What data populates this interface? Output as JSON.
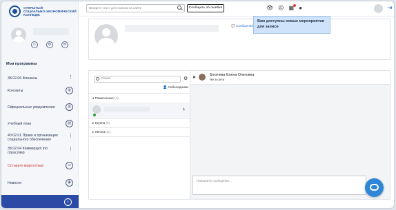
{
  "logo": {
    "line1": "ОТКРЫТЫЙ",
    "line2": "СОЦИАЛЬНО-ЭКОНОМИЧЕСКИЙ",
    "line3": "КОЛЛЕДЖ"
  },
  "sidebar": {
    "section_title": "Мои программы",
    "items": [
      {
        "label": "38.02.06 Финансы",
        "icon": "more-vert-icon"
      },
      {
        "label": "Контакты",
        "icon": "contacts-icon"
      },
      {
        "label": "Официальные уведомления",
        "icon": "notifications-icon"
      },
      {
        "label": "Учебный план",
        "icon": "plan-icon"
      },
      {
        "label": "40.02.01 Право и организация социального обеспечения",
        "icon": "more-vert-icon"
      },
      {
        "label": "38.02.04 Коммерция (по отраслям)",
        "icon": "more-vert-icon"
      },
      {
        "label": "Оставьте видеоотзыв",
        "icon": "video-icon"
      },
      {
        "label": "Новости",
        "icon": "news-icon"
      }
    ],
    "collapse_icon": "arrow-left-icon"
  },
  "topbar": {
    "search_placeholder": "Введите текст для поиска на сайте",
    "report_label": "Сообщить об ошибке",
    "icons": [
      "eye-icon",
      "smiley-icon",
      "calendar-icon",
      "chat-bubble-icon"
    ]
  },
  "tooltip": {
    "text": "Вам доступны новые мероприятия для записи"
  },
  "profile": {
    "message_link": "Сообщение"
  },
  "messenger": {
    "search_placeholder": "Поиск",
    "contacts_label": "Собеседники",
    "groups": [
      {
        "label": "Помеченные",
        "count": "(1)"
      },
      {
        "label": "Группа",
        "count": "(0)"
      },
      {
        "label": "Личное",
        "count": "(2)"
      }
    ],
    "chat": {
      "name": "Богачева Елена Олеговна",
      "status": "Не в сети",
      "composer_placeholder": "Напишите сообщение..."
    }
  },
  "colors": {
    "accent": "#2a4aa6",
    "link": "#2a6fd6",
    "tooltip_bg": "#cfe3fa",
    "online": "#2e9d3c"
  }
}
